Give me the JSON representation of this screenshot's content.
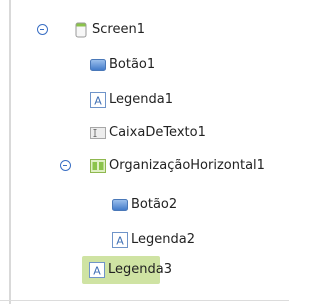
{
  "tree": {
    "screen": {
      "label": "Screen1",
      "icon": "screen-icon"
    },
    "children": [
      {
        "label": "Botão1",
        "icon": "button-icon"
      },
      {
        "label": "Legenda1",
        "icon": "label-icon"
      },
      {
        "label": "CaixaDeTexto1",
        "icon": "textbox-icon"
      },
      {
        "label": "OrganizaçãoHorizontal1",
        "icon": "horizontal-arrangement-icon"
      },
      {
        "label": "Botão2",
        "icon": "button-icon"
      },
      {
        "label": "Legenda2",
        "icon": "label-icon"
      },
      {
        "label": "Legenda3",
        "icon": "label-icon",
        "selected": true
      }
    ]
  },
  "colors": {
    "selection": "#cfe3a3",
    "toggle": "#3a6fc4"
  }
}
